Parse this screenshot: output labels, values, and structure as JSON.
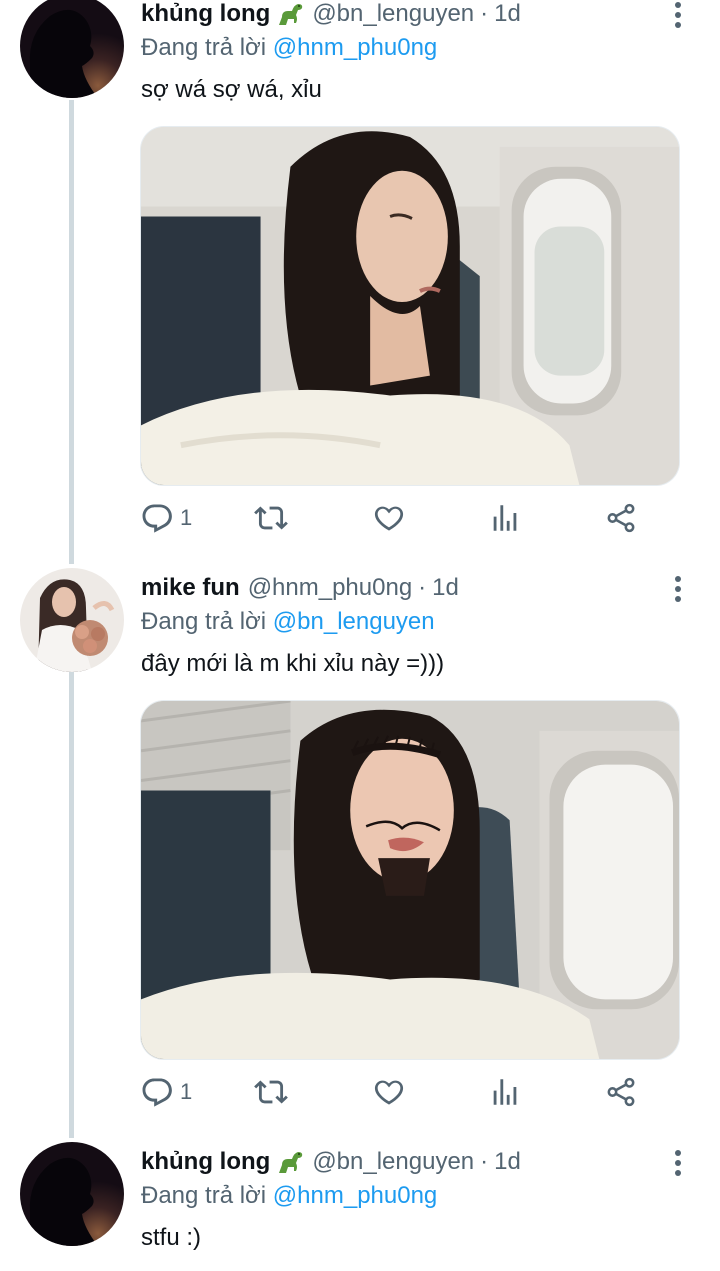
{
  "tweets": [
    {
      "name": "khủng long",
      "handle": "@bn_lenguyen",
      "dot": "·",
      "time": "1d",
      "reply_prefix": "Đang trả lời",
      "reply_to": "@hnm_phu0ng",
      "text": "sợ wá sợ wá, xỉu",
      "reply_count": "1"
    },
    {
      "name": "mike fun",
      "handle": "@hnm_phu0ng",
      "dot": "·",
      "time": "1d",
      "reply_prefix": "Đang trả lời",
      "reply_to": "@bn_lenguyen",
      "text": "đây mới là m khi xỉu này =)))",
      "reply_count": "1"
    },
    {
      "name": "khủng long",
      "handle": "@bn_lenguyen",
      "dot": "·",
      "time": "1d",
      "reply_prefix": "Đang trả lời",
      "reply_to": "@hnm_phu0ng",
      "text": "stfu :)"
    }
  ],
  "icons": {
    "reply": "reply-icon",
    "retweet": "retweet-icon",
    "like": "heart-icon",
    "views": "analytics-icon",
    "share": "share-icon",
    "more": "more-vertical-icon",
    "name_emoji": "dinosaur-emoji"
  },
  "colors": {
    "mention": "#1d9bf0",
    "secondary_text": "#536471",
    "thread_line": "#cfd9de"
  }
}
